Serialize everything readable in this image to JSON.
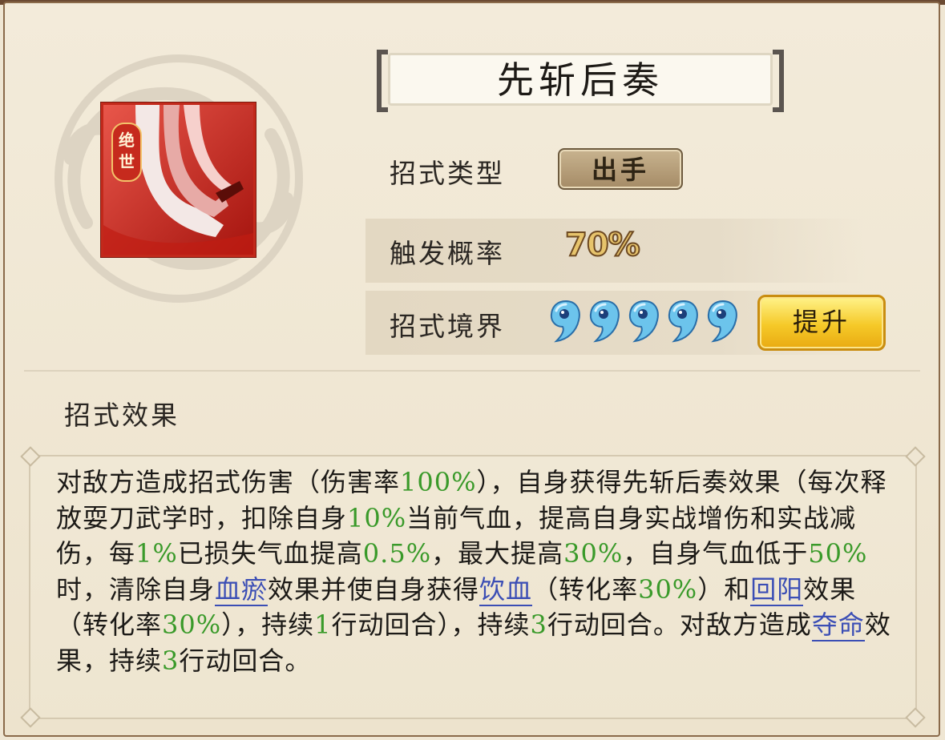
{
  "skill": {
    "name": "先斩后奏",
    "icon_tag": "绝世",
    "icon": "red-ribbon-blade-icon"
  },
  "rows": {
    "type_label": "招式类型",
    "type_value": "出手",
    "rate_label": "触发概率",
    "rate_value": "70%",
    "level_label": "招式境界",
    "level_drops": 5,
    "upgrade_label": "提升"
  },
  "effect": {
    "title": "招式效果",
    "segments": [
      {
        "t": "对敌方造成招式伤害（伤害率",
        "s": "n"
      },
      {
        "t": "100%",
        "s": "g"
      },
      {
        "t": "），自身获得先斩后奏效果（每次释放耍刀武学时，扣除自身",
        "s": "n"
      },
      {
        "t": "10%",
        "s": "g"
      },
      {
        "t": "当前气血，提高自身实战增伤和实战减伤，每",
        "s": "n"
      },
      {
        "t": "1%",
        "s": "g"
      },
      {
        "t": "已损失气血提高",
        "s": "n"
      },
      {
        "t": "0.5%",
        "s": "g"
      },
      {
        "t": "，最大提高",
        "s": "n"
      },
      {
        "t": "30%",
        "s": "g"
      },
      {
        "t": "，自身气血低于",
        "s": "n"
      },
      {
        "t": "50%",
        "s": "g"
      },
      {
        "t": "时，清除自身",
        "s": "n"
      },
      {
        "t": "血瘀",
        "s": "b"
      },
      {
        "t": "效果并使自身获得",
        "s": "n"
      },
      {
        "t": "饮血",
        "s": "b"
      },
      {
        "t": "（转化率",
        "s": "n"
      },
      {
        "t": "30%",
        "s": "g"
      },
      {
        "t": "）和",
        "s": "n"
      },
      {
        "t": "回阳",
        "s": "b"
      },
      {
        "t": "效果（转化率",
        "s": "n"
      },
      {
        "t": "30%",
        "s": "g"
      },
      {
        "t": "），持续",
        "s": "n"
      },
      {
        "t": "1",
        "s": "g"
      },
      {
        "t": "行动回合），持续",
        "s": "n"
      },
      {
        "t": "3",
        "s": "g"
      },
      {
        "t": "行动回合。对敌方造成",
        "s": "n"
      },
      {
        "t": "夺命",
        "s": "b"
      },
      {
        "t": "效果，持续",
        "s": "n"
      },
      {
        "t": "3",
        "s": "g"
      },
      {
        "t": "行动回合。",
        "s": "n"
      }
    ]
  },
  "colors": {
    "highlight_green": "#3a9a2a",
    "keyword_blue": "#3b4eb5",
    "upgrade_gold": "#f5c928",
    "icon_red": "#d8281c"
  }
}
